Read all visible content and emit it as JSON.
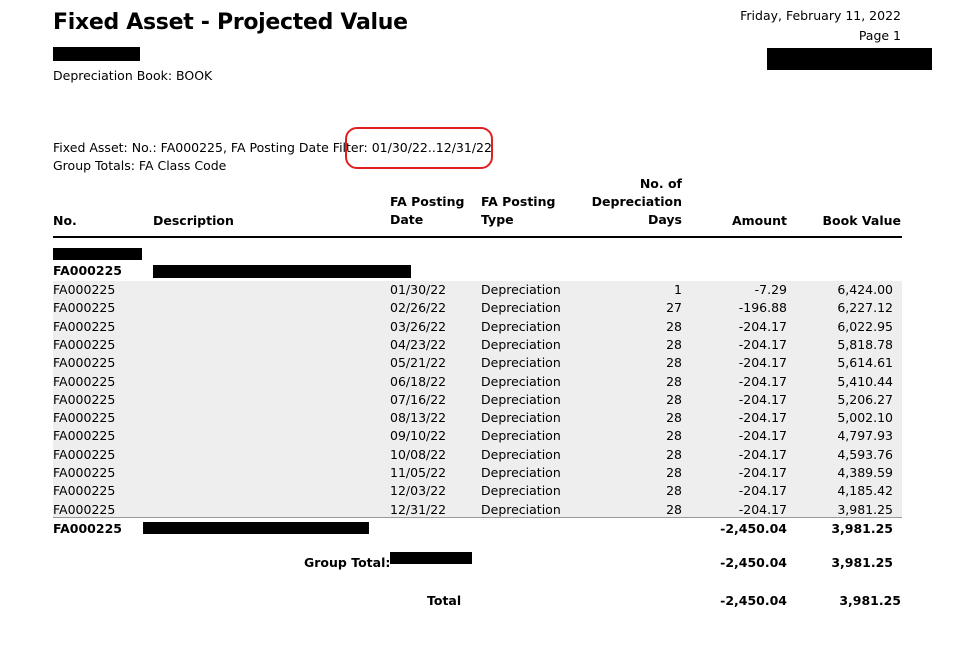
{
  "report": {
    "title": "Fixed Asset - Projected Value",
    "date": "Friday, February 11, 2022",
    "page": "Page 1",
    "depreciation_book": "Depreciation Book: BOOK",
    "filter_prefix": "Fixed Asset: No.: FA000225, FA Posting Date Filter: ",
    "filter_value": "01/30/22..12/31/22",
    "group_totals": "Group Totals: FA Class Code"
  },
  "columns": {
    "no": "No.",
    "description": "Description",
    "fa_posting_date_1": "FA Posting",
    "fa_posting_date_2": "Date",
    "fa_posting_type_1": "FA Posting",
    "fa_posting_type_2": "Type",
    "days_1": "No. of",
    "days_2": "Depreciation",
    "days_3": "Days",
    "amount": "Amount",
    "book_value": "Book Value"
  },
  "asset_header": {
    "no": "FA000225"
  },
  "rows": [
    {
      "no": "FA000225",
      "date": "01/30/22",
      "type": "Depreciation",
      "days": "1",
      "amount": "-7.29",
      "book_value": "6,424.00"
    },
    {
      "no": "FA000225",
      "date": "02/26/22",
      "type": "Depreciation",
      "days": "27",
      "amount": "-196.88",
      "book_value": "6,227.12"
    },
    {
      "no": "FA000225",
      "date": "03/26/22",
      "type": "Depreciation",
      "days": "28",
      "amount": "-204.17",
      "book_value": "6,022.95"
    },
    {
      "no": "FA000225",
      "date": "04/23/22",
      "type": "Depreciation",
      "days": "28",
      "amount": "-204.17",
      "book_value": "5,818.78"
    },
    {
      "no": "FA000225",
      "date": "05/21/22",
      "type": "Depreciation",
      "days": "28",
      "amount": "-204.17",
      "book_value": "5,614.61"
    },
    {
      "no": "FA000225",
      "date": "06/18/22",
      "type": "Depreciation",
      "days": "28",
      "amount": "-204.17",
      "book_value": "5,410.44"
    },
    {
      "no": "FA000225",
      "date": "07/16/22",
      "type": "Depreciation",
      "days": "28",
      "amount": "-204.17",
      "book_value": "5,206.27"
    },
    {
      "no": "FA000225",
      "date": "08/13/22",
      "type": "Depreciation",
      "days": "28",
      "amount": "-204.17",
      "book_value": "5,002.10"
    },
    {
      "no": "FA000225",
      "date": "09/10/22",
      "type": "Depreciation",
      "days": "28",
      "amount": "-204.17",
      "book_value": "4,797.93"
    },
    {
      "no": "FA000225",
      "date": "10/08/22",
      "type": "Depreciation",
      "days": "28",
      "amount": "-204.17",
      "book_value": "4,593.76"
    },
    {
      "no": "FA000225",
      "date": "11/05/22",
      "type": "Depreciation",
      "days": "28",
      "amount": "-204.17",
      "book_value": "4,389.59"
    },
    {
      "no": "FA000225",
      "date": "12/03/22",
      "type": "Depreciation",
      "days": "28",
      "amount": "-204.17",
      "book_value": "4,185.42"
    },
    {
      "no": "FA000225",
      "date": "12/31/22",
      "type": "Depreciation",
      "days": "28",
      "amount": "-204.17",
      "book_value": "3,981.25"
    }
  ],
  "asset_total": {
    "no": "FA000225",
    "amount": "-2,450.04",
    "book_value": "3,981.25"
  },
  "group_total": {
    "label": "Group Total:",
    "amount": "-2,450.04",
    "book_value": "3,981.25"
  },
  "grand_total": {
    "label": "Total",
    "amount": "-2,450.04",
    "book_value": "3,981.25"
  },
  "colors": {
    "highlight": "#e02020",
    "shade": "#eeeeee"
  }
}
